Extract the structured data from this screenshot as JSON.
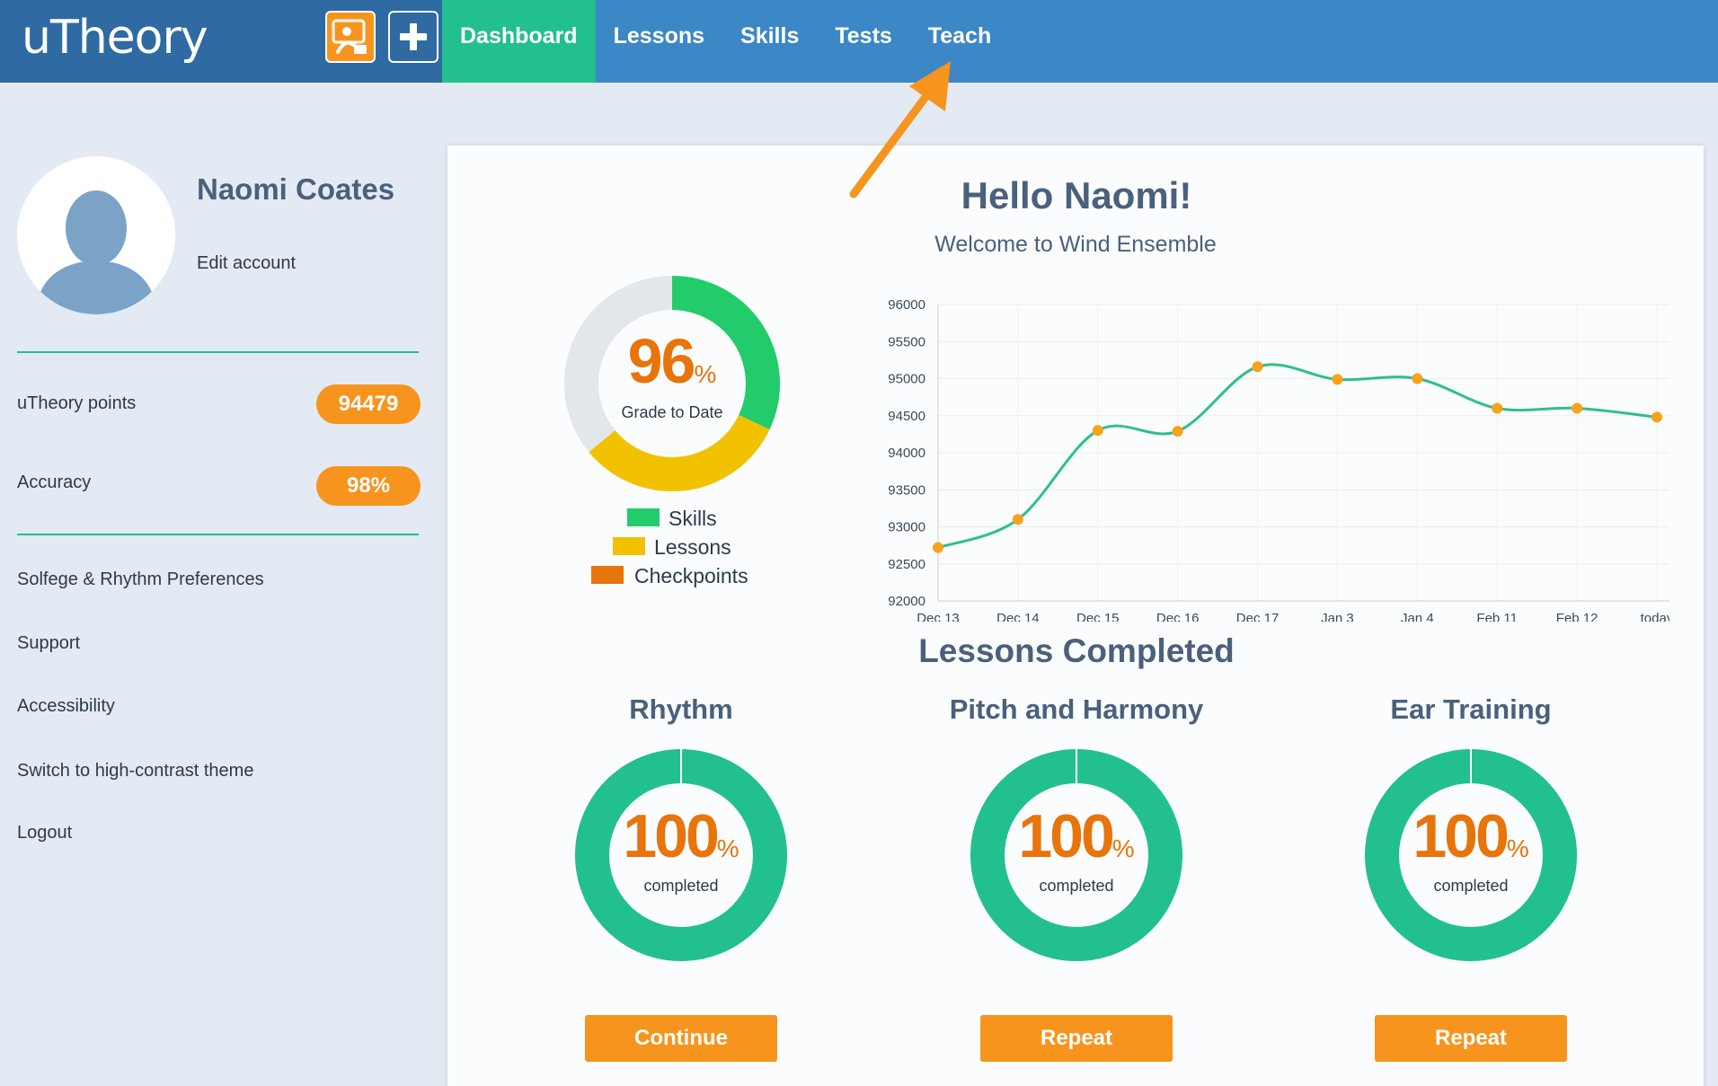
{
  "app": {
    "logo": "uTheory"
  },
  "header": {
    "teach_icon": "teacher-icon",
    "add_icon": "plus-icon",
    "nav": [
      {
        "label": "Dashboard",
        "active": true
      },
      {
        "label": "Lessons",
        "active": false
      },
      {
        "label": "Skills",
        "active": false
      },
      {
        "label": "Tests",
        "active": false
      },
      {
        "label": "Teach",
        "active": false
      }
    ]
  },
  "sidebar": {
    "avatar_icon": "user-silhouette-icon",
    "name": "Naomi Coates",
    "edit_account": "Edit account",
    "stats": [
      {
        "label": "uTheory points",
        "value": "94479"
      },
      {
        "label": "Accuracy",
        "value": "98%"
      }
    ],
    "links": [
      "Solfege & Rhythm Preferences",
      "Support",
      "Accessibility",
      "Switch to high-contrast theme",
      "Logout"
    ]
  },
  "main": {
    "greeting": "Hello Naomi!",
    "welcome": "Welcome to Wind Ensemble",
    "grade": {
      "value": "96",
      "unit": "%",
      "caption": "Grade to Date",
      "segments": [
        {
          "name": "Skills",
          "fraction": 0.32,
          "color": "#22cc6a"
        },
        {
          "name": "Lessons",
          "fraction": 0.32,
          "color": "#f2c200"
        },
        {
          "name": "Checkpoints",
          "fraction": 0.0,
          "color": "#e8740c"
        }
      ],
      "remainder_color": "#e3e6ea"
    },
    "legend": [
      {
        "label": "Skills",
        "color": "#22cc6a"
      },
      {
        "label": "Lessons",
        "color": "#f2c200"
      },
      {
        "label": "Checkpoints",
        "color": "#e8740c"
      }
    ],
    "lessons_title": "Lessons Completed",
    "lessons": [
      {
        "title": "Rhythm",
        "value": "100",
        "unit": "%",
        "caption": "completed",
        "fraction": 1.0,
        "button": "Continue"
      },
      {
        "title": "Pitch and Harmony",
        "value": "100",
        "unit": "%",
        "caption": "completed",
        "fraction": 1.0,
        "button": "Repeat"
      },
      {
        "title": "Ear Training",
        "value": "100",
        "unit": "%",
        "caption": "completed",
        "fraction": 1.0,
        "button": "Repeat"
      }
    ],
    "colors": {
      "accent": "#22c08e",
      "orange": "#f7941d",
      "nav": "#3c87c6"
    }
  },
  "annotation": {
    "icon": "arrow-icon",
    "color": "#f7941d",
    "target": "Teach"
  },
  "chart_data": {
    "type": "line",
    "categories": [
      "Dec 13",
      "Dec 14",
      "Dec 15",
      "Dec 16",
      "Dec 17",
      "Jan 3",
      "Jan 4",
      "Feb 11",
      "Feb 12",
      "today"
    ],
    "values": [
      92720,
      93100,
      94300,
      94290,
      95160,
      94990,
      95000,
      94600,
      94600,
      94480
    ],
    "ylim": [
      92000,
      96000
    ],
    "yticks": [
      "92000",
      "92500",
      "93000",
      "93500",
      "94000",
      "94500",
      "95000",
      "95500",
      "96000"
    ],
    "grid": true,
    "line_color": "#2ec088",
    "point_color": "#f7a21b"
  }
}
